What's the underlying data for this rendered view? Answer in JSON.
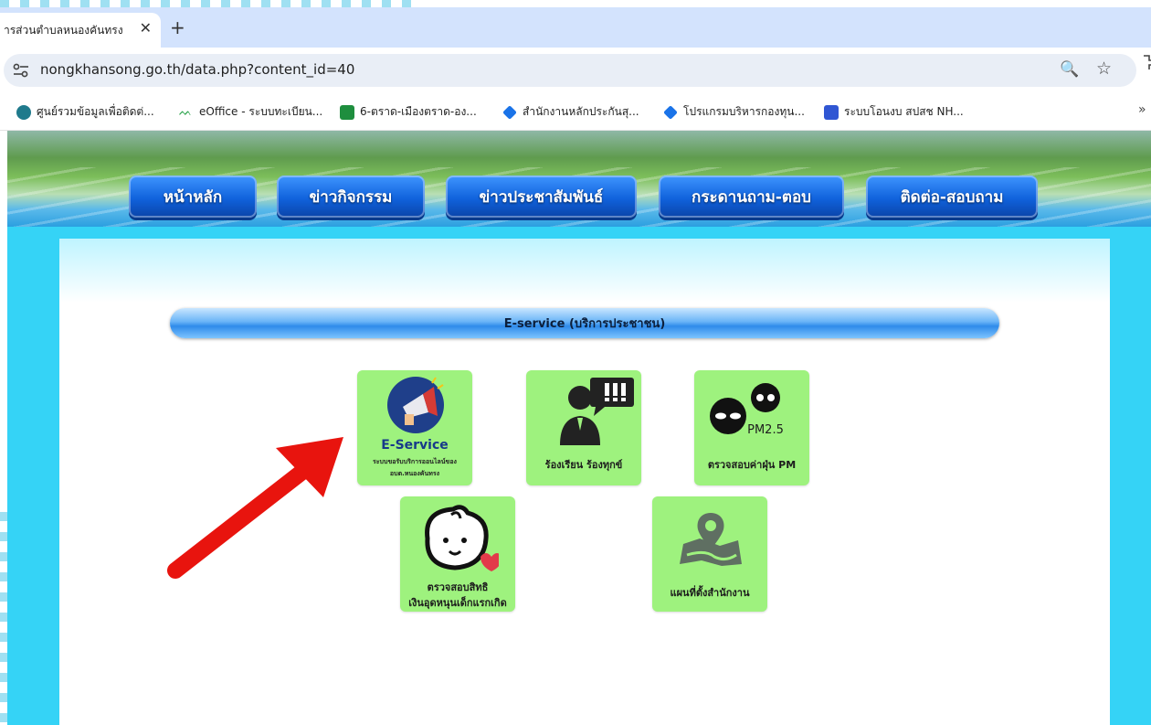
{
  "browser": {
    "tab_title": "ารส่วนตำบลหนองคันทรง",
    "new_tab_symbol": "+",
    "close_symbol": "✕",
    "url": "nongkhansong.go.th/data.php?content_id=40",
    "zoom_symbol": "🔍",
    "star_symbol": "☆",
    "ext_symbol": "ﾍ",
    "bookmarks": [
      {
        "label": "ศูนย์รวมข้อมูลเพื่อติดต่...",
        "icon": "database-icon",
        "color": "#1f7a8c"
      },
      {
        "label": "eOffice - ระบบทะเบียน...",
        "icon": "eoffice-icon",
        "color": "#2aa34a"
      },
      {
        "label": "6-ตราด-เมืองตราด-อง...",
        "icon": "sheets-icon",
        "color": "#1e8e3e"
      },
      {
        "label": "สำนักงานหลักประกันสุ...",
        "icon": "nhso-icon",
        "color": "#1a73e8"
      },
      {
        "label": "โปรแกรมบริหารกองทุน...",
        "icon": "nhso-icon",
        "color": "#1a73e8"
      },
      {
        "label": "ระบบโอนงบ สปสช NH...",
        "icon": "chart-icon",
        "color": "#3056d3"
      }
    ],
    "more_symbol": "»"
  },
  "nav": [
    {
      "label": "หน้าหลัก"
    },
    {
      "label": "ข่าวกิจกรรม"
    },
    {
      "label": "ข่าวประชาสัมพันธ์"
    },
    {
      "label": "กระดานถาม-ตอบ"
    },
    {
      "label": "ติดต่อ-สอบถาม"
    }
  ],
  "section": {
    "title": "E-service (บริการประชาชน)"
  },
  "tiles": {
    "eservice": {
      "title": "E-Service",
      "subtitle1": "ระบบขอรับบริการออนไลน์ของ",
      "subtitle2": "อบต.หนองคันทรง"
    },
    "complaint": {
      "label": "ร้องเรียน ร้องทุกข์"
    },
    "pm": {
      "badge": "PM2.5",
      "label": "ตรวจสอบค่าฝุ่น PM"
    },
    "child": {
      "label1": "ตรวจสอบสิทธิ",
      "label2": "เงินอุดหนุนเด็กแรกเกิด"
    },
    "map": {
      "label": "แผนที่ตั้งสำนักงาน"
    }
  },
  "colors": {
    "tile": "#9ef27e",
    "page_bg": "#35d3f6",
    "arrow": "#e8140e"
  }
}
